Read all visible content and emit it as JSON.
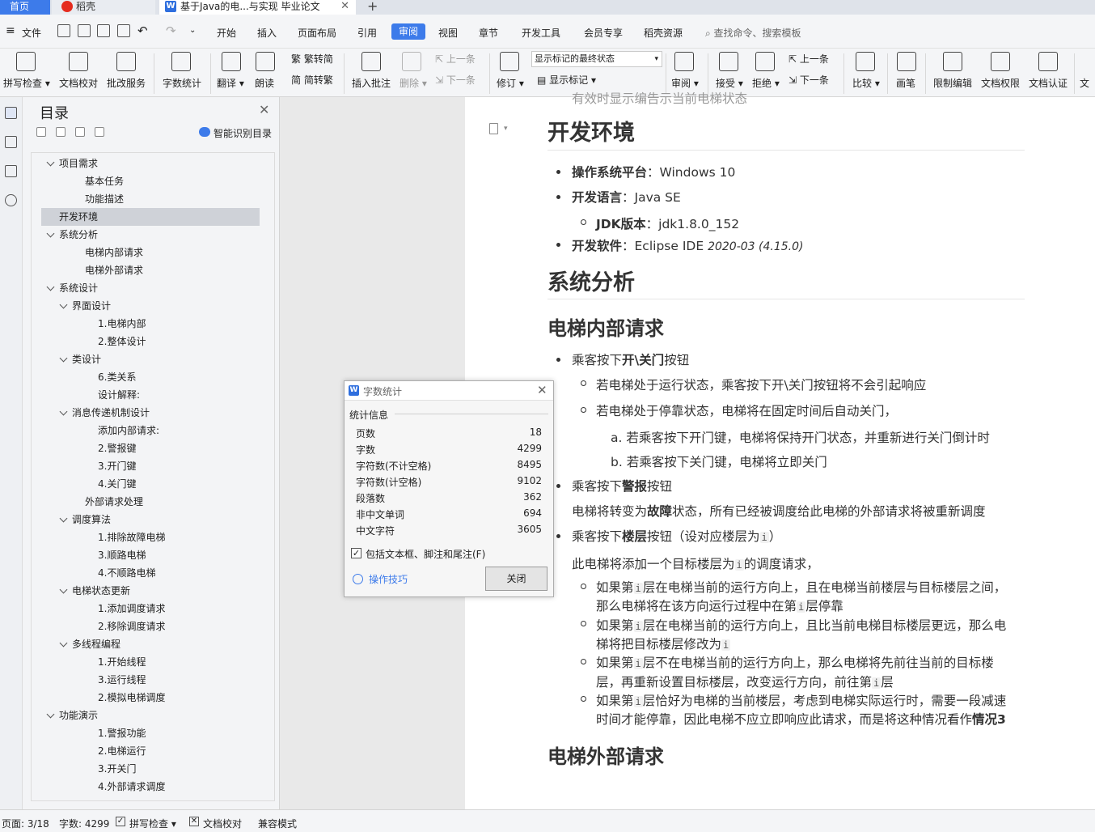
{
  "tabs": {
    "home": "首页",
    "daoke": "稻壳",
    "doc": "基于Java的电...与实现 毕业论文",
    "add": "+"
  },
  "menubar": {
    "file": "文件",
    "items": [
      "开始",
      "插入",
      "页面布局",
      "引用",
      "审阅",
      "视图",
      "章节",
      "开发工具",
      "会员专享",
      "稻壳资源"
    ],
    "active": "审阅",
    "search": "查找命令、搜索模板"
  },
  "ribbon": {
    "spell_check": "拼写检查",
    "doc_proof": "文档校对",
    "batch_service": "批改服务",
    "word_count": "字数统计",
    "translate": "翻译",
    "read_aloud": "朗读",
    "trad_convert": "繁转简",
    "simp_convert": "简转繁",
    "insert_comment": "插入批注",
    "delete": "删除",
    "prev": "上一条",
    "next": "下一条",
    "revise": "修订",
    "display_select": "显示标记的最终状态",
    "show_marks": "显示标记",
    "review": "审阅",
    "accept": "接受",
    "reject": "拒绝",
    "prev2": "上一条",
    "next2": "下一条",
    "compare": "比较",
    "pen": "画笔",
    "restrict_edit": "限制编辑",
    "doc_permission": "文档权限",
    "doc_cert": "文档认证",
    "doc_more": "文"
  },
  "toc": {
    "title": "目录",
    "smart": "智能识别目录",
    "items": [
      {
        "label": "项目需求",
        "level": 1,
        "arrow": true
      },
      {
        "label": "基本任务",
        "level": 2,
        "arrow": false
      },
      {
        "label": "功能描述",
        "level": 2,
        "arrow": false
      },
      {
        "label": "开发环境",
        "level": 1,
        "arrow": false,
        "selected": true
      },
      {
        "label": "系统分析",
        "level": 1,
        "arrow": true
      },
      {
        "label": "电梯内部请求",
        "level": 2,
        "arrow": false
      },
      {
        "label": "电梯外部请求",
        "level": 2,
        "arrow": false
      },
      {
        "label": "系统设计",
        "level": 1,
        "arrow": true
      },
      {
        "label": "界面设计",
        "level": 2,
        "arrow": true
      },
      {
        "label": "1.电梯内部",
        "level": 3,
        "arrow": false
      },
      {
        "label": "2.整体设计",
        "level": 3,
        "arrow": false
      },
      {
        "label": "类设计",
        "level": 2,
        "arrow": true
      },
      {
        "label": "6.类关系",
        "level": 3,
        "arrow": false
      },
      {
        "label": "设计解释:",
        "level": 3,
        "arrow": false
      },
      {
        "label": "消息传递机制设计",
        "level": 2,
        "arrow": true
      },
      {
        "label": "添加内部请求:",
        "level": 3,
        "arrow": false
      },
      {
        "label": "2.警报键",
        "level": 3,
        "arrow": false
      },
      {
        "label": "3.开门键",
        "level": 3,
        "arrow": false
      },
      {
        "label": "4.关门键",
        "level": 3,
        "arrow": false
      },
      {
        "label": "外部请求处理",
        "level": 2,
        "arrow": false
      },
      {
        "label": "调度算法",
        "level": 2,
        "arrow": true
      },
      {
        "label": "1.排除故障电梯",
        "level": 3,
        "arrow": false
      },
      {
        "label": "3.顺路电梯",
        "level": 3,
        "arrow": false
      },
      {
        "label": "4.不顺路电梯",
        "level": 3,
        "arrow": false
      },
      {
        "label": "电梯状态更新",
        "level": 2,
        "arrow": true
      },
      {
        "label": "1.添加调度请求",
        "level": 3,
        "arrow": false
      },
      {
        "label": "2.移除调度请求",
        "level": 3,
        "arrow": false
      },
      {
        "label": "多线程编程",
        "level": 2,
        "arrow": true
      },
      {
        "label": "1.开始线程",
        "level": 3,
        "arrow": false
      },
      {
        "label": "3.运行线程",
        "level": 3,
        "arrow": false
      },
      {
        "label": "2.模拟电梯调度",
        "level": 3,
        "arrow": false
      },
      {
        "label": "功能演示",
        "level": 1,
        "arrow": true
      },
      {
        "label": "1.警报功能",
        "level": 3,
        "arrow": false
      },
      {
        "label": "2.电梯运行",
        "level": 3,
        "arrow": false
      },
      {
        "label": "3.开关门",
        "level": 3,
        "arrow": false
      },
      {
        "label": "4.外部请求调度",
        "level": 3,
        "arrow": false
      }
    ]
  },
  "doc": {
    "top_cut": "有效时显示编告示当前电梯状态",
    "h_dev": "开发环境",
    "os_label": "操作系统平台",
    "os_val": "：Windows 10",
    "lang_label": "开发语言",
    "lang_val": "：Java SE",
    "jdk_label": "JDK版本",
    "jdk_val": "：jdk1.8.0_152",
    "ide_label": "开发软件",
    "ide_val": "：Eclipse IDE ",
    "ide_ver": "2020-03 (4.15.0)",
    "h_analysis": "系统分析",
    "h_inner": "电梯内部请求",
    "b1_pre": "乘客按下",
    "b1_bold": "开\\关门",
    "b1_post": "按钮",
    "c1": "若电梯处于运行状态，乘客按下开\\关门按钮将不会引起响应",
    "c2": "若电梯处于停靠状态，电梯将在固定时间后自动关门，",
    "a1": "a. 若乘客按下开门键，电梯将保持开门状态，并重新进行关门倒计时",
    "a2": "b. 若乘客按下关门键，电梯将立即关门",
    "b2_pre": "乘客按下",
    "b2_bold": "警报",
    "b2_post": "按钮",
    "p1_pre": "电梯将转变为",
    "p1_bold": "故障",
    "p1_post": "状态，所有已经被调度给此电梯的外部请求将被重新调度",
    "b3_pre": "乘客按下",
    "b3_bold": "楼层",
    "b3_post": "按钮（设对应楼层为",
    "b3_end": "）",
    "code_i": "i",
    "p2_pre": "此电梯将添加一个目标楼层为",
    "p2_post": "的调度请求，",
    "d1_l1_pre": "如果第",
    "d1_l1_post": "层在电梯当前的运行方向上，且在电梯当前楼层与目标楼层之间，",
    "d1_l2_pre": "那么电梯将在该方向运行过程中在第",
    "d1_l2_post": "层停靠",
    "d2_l1_pre": "如果第",
    "d2_l1_post": "层在电梯当前的运行方向上，且比当前电梯目标楼层更远，那么电",
    "d2_l2": "梯将把目标楼层修改为",
    "d3_l1_pre": "如果第",
    "d3_l1_post": "层不在电梯当前的运行方向上，那么电梯将先前往当前的目标楼",
    "d3_l2_pre": "层，再重新设置目标楼层，改变运行方向，前往第",
    "d3_l2_post": "层",
    "d4_l1_pre": "如果第",
    "d4_l1_post": "层恰好为电梯的当前楼层，考虑到电梯实际运行时，需要一段减速",
    "d4_l2_pre": "时间才能停靠，因此电梯不应立即响应此请求，而是将这种情况看作",
    "d4_l2_bold": "情况3",
    "h_outer": "电梯外部请求"
  },
  "dialog": {
    "title": "字数统计",
    "group": "统计信息",
    "rows": [
      {
        "label": "页数",
        "value": "18"
      },
      {
        "label": "字数",
        "value": "4299"
      },
      {
        "label": "字符数(不计空格)",
        "value": "8495"
      },
      {
        "label": "字符数(计空格)",
        "value": "9102"
      },
      {
        "label": "段落数",
        "value": "362"
      },
      {
        "label": "非中文单词",
        "value": "694"
      },
      {
        "label": "中文字符",
        "value": "3605"
      }
    ],
    "checkbox_label": "包括文本框、脚注和尾注(F)",
    "checkbox_checked": true,
    "tips": "操作技巧",
    "close_btn": "关闭"
  },
  "status": {
    "page": "页面: 3/18",
    "words": "字数: 4299",
    "spell": "拼写检查",
    "proof": "文档校对",
    "compat": "兼容模式"
  },
  "colors": {
    "accent": "#3d7bea",
    "selected": "#cfd2d8"
  }
}
